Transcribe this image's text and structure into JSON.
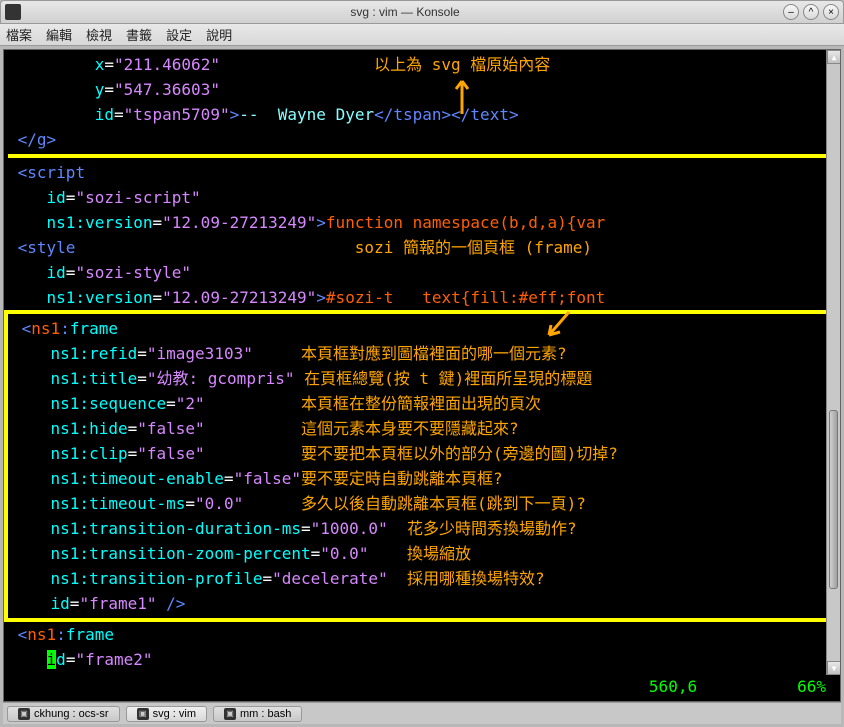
{
  "titlebar": {
    "title": "svg : vim — Konsole"
  },
  "menubar": {
    "items": [
      "檔案",
      "編輯",
      "檢視",
      "書籤",
      "設定",
      "說明"
    ]
  },
  "annotations": {
    "top": "以上為 svg 檔原始內容",
    "sozi": "sozi 簡報的一個頁框 (frame)",
    "refid": "本頁框對應到圖檔裡面的哪一個元素?",
    "title": "在頁框總覽(按 t 鍵)裡面所呈現的標題",
    "sequence": "本頁框在整份簡報裡面出現的頁次",
    "hide": "這個元素本身要不要隱藏起來?",
    "clip": "要不要把本頁框以外的部分(旁邊的圖)切掉?",
    "timeout_enable": "要不要定時自動跳離本頁框?",
    "timeout_ms": "多久以後自動跳離本頁框(跳到下一頁)?",
    "duration": "花多少時間秀換場動作?",
    "zoom": "換場縮放",
    "profile": "採用哪種換場特效?"
  },
  "code": {
    "x_val": "211.46062",
    "y_val": "547.36603",
    "tspan_id": "tspan5709",
    "tspan_text": "--  Wayne Dyer",
    "script_id": "sozi-script",
    "version": "12.09-27213249",
    "fn_text": "function namespace(b,d,a){var",
    "style_id": "sozi-style",
    "style_text": "#sozi-t   text{fill:#eff;font",
    "refid": "image3103",
    "title_val": "幼教: gcompris",
    "sequence": "2",
    "hide": "false",
    "clip": "false",
    "timeout_enable": "false",
    "timeout_ms": "0.0",
    "duration": "1000.0",
    "zoom": "0.0",
    "profile": "decelerate",
    "frame1_id": "frame1",
    "frame2_id": "frame2"
  },
  "status": {
    "position": "560,6",
    "percent": "66%"
  },
  "tabs": [
    {
      "label": "ckhung : ocs-sr"
    },
    {
      "label": "svg : vim"
    },
    {
      "label": "mm : bash"
    }
  ]
}
